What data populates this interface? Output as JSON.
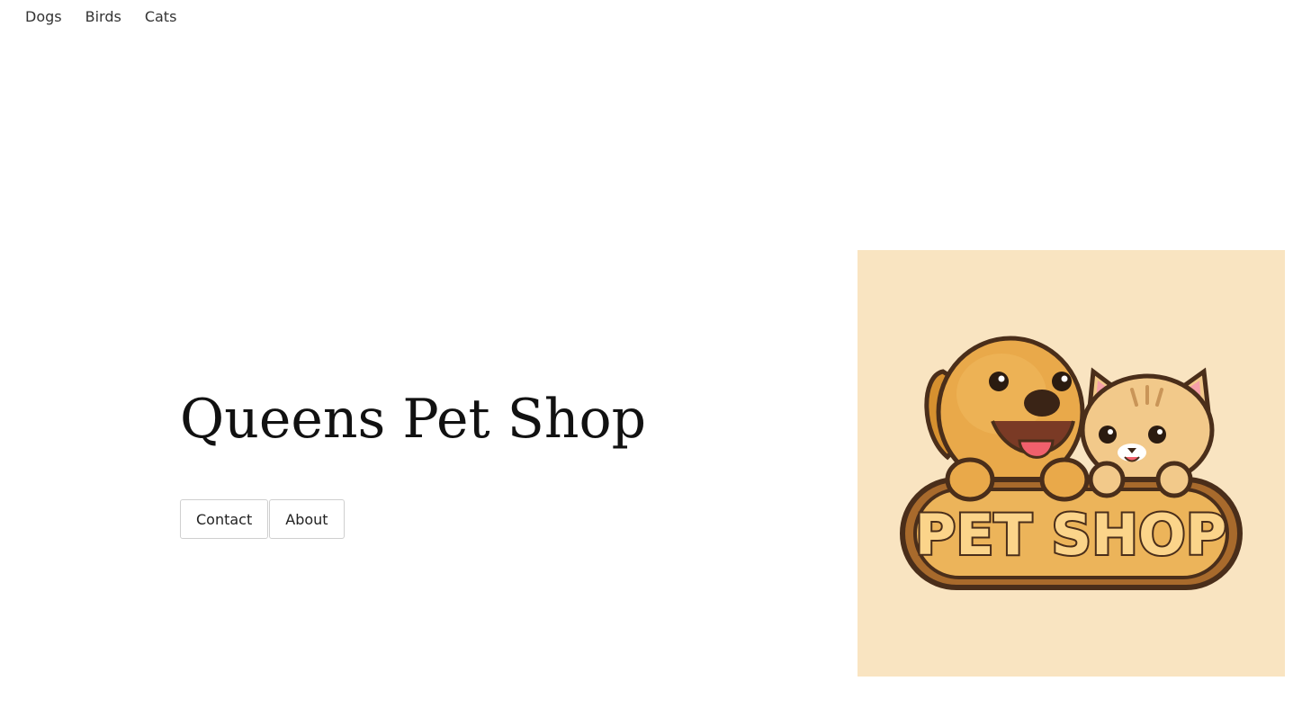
{
  "nav": {
    "items": [
      {
        "label": "Dogs"
      },
      {
        "label": "Birds"
      },
      {
        "label": "Cats"
      }
    ]
  },
  "hero": {
    "title": "Queens Pet Shop",
    "buttons": [
      {
        "label": "Contact"
      },
      {
        "label": "About"
      }
    ]
  },
  "logo": {
    "text": "PET SHOP",
    "colors": {
      "background": "#f9e4c1",
      "dog": "#e9a94a",
      "cat": "#f2c98a",
      "outline": "#4a2e1a",
      "plaque": "#ecb45a",
      "text_fill": "#fbd48a"
    }
  }
}
